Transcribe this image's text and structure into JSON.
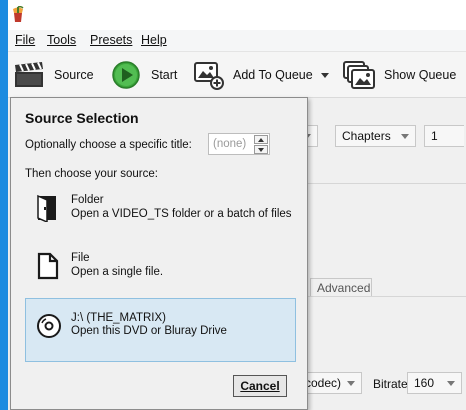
{
  "menu": {
    "file": "File",
    "tools": "Tools",
    "presets": "Presets",
    "help": "Help"
  },
  "toolbar": {
    "source_label": "Source",
    "start_label": "Start",
    "add_to_queue_label": "Add To Queue",
    "show_queue_label": "Show Queue"
  },
  "background": {
    "range_mode": "Chapters",
    "range_start": "1",
    "tab_advanced": "Advanced",
    "codec_fragment": "codec)",
    "bitrate_label": "Bitrate",
    "bitrate_value": "160"
  },
  "source_selection": {
    "title": "Source Selection",
    "choose_title_label": "Optionally choose a specific title:",
    "title_value": "(none)",
    "choose_source_label": "Then choose your source:",
    "options": [
      {
        "name": "Folder",
        "description": "Open a VIDEO_TS folder or a batch of files",
        "icon": "folder-icon"
      },
      {
        "name": "File",
        "description": "Open a single file.",
        "icon": "file-icon"
      },
      {
        "name": "J:\\ (THE_MATRIX)",
        "description": "Open this DVD or Bluray Drive",
        "icon": "disc-icon",
        "selected": true
      }
    ],
    "cancel_label": "Cancel"
  },
  "colors": {
    "window_frame": "#1c8be0",
    "selected_bg": "#d8e8f3",
    "selected_border": "#8fc0e0",
    "start_green": "#3aa53a"
  }
}
